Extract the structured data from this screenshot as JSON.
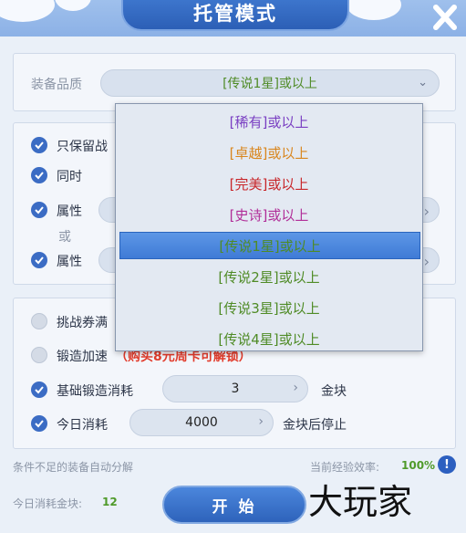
{
  "header": {
    "title": "托管模式"
  },
  "quality": {
    "label": "装备品质",
    "selected": "[传说1星]或以上"
  },
  "filters": {
    "keep_battle": "只保留战",
    "same_time": "同时",
    "attr1": "属性",
    "or_text": "或",
    "attr2": "属性"
  },
  "options": {
    "ticket_full": "挑战券满",
    "forge_speed": "锻造加速",
    "forge_speed_lock": "（购买8元周卡可解锁）",
    "base_forge": "基础锻造消耗",
    "base_forge_value": "3",
    "base_forge_unit": "金块",
    "today_cost": "今日消耗",
    "today_cost_value": "4000",
    "today_cost_unit": "金块后停止"
  },
  "footer": {
    "auto_decompose": "条件不足的装备自动分解",
    "efficiency_label": "当前经验效率:",
    "efficiency_value": "100%",
    "today_gold_label": "今日消耗金块:",
    "today_gold_value": "12",
    "start_label": "开 始",
    "info_glyph": "!"
  },
  "dropdown": {
    "items": [
      {
        "text": "[稀有]或以上",
        "color": "#7a3fc2"
      },
      {
        "text": "[卓越]或以上",
        "color": "#d9861e"
      },
      {
        "text": "[完美]或以上",
        "color": "#c8262a"
      },
      {
        "text": "[史诗]或以上",
        "color": "#b12d98"
      },
      {
        "text": "[传说1星]或以上",
        "color": "#4f8b26"
      },
      {
        "text": "[传说2星]或以上",
        "color": "#4f8b26"
      },
      {
        "text": "[传说3星]或以上",
        "color": "#4f8b26"
      },
      {
        "text": "[传说4星]或以上",
        "color": "#4f8b26"
      }
    ]
  },
  "watermark": "大玩家"
}
